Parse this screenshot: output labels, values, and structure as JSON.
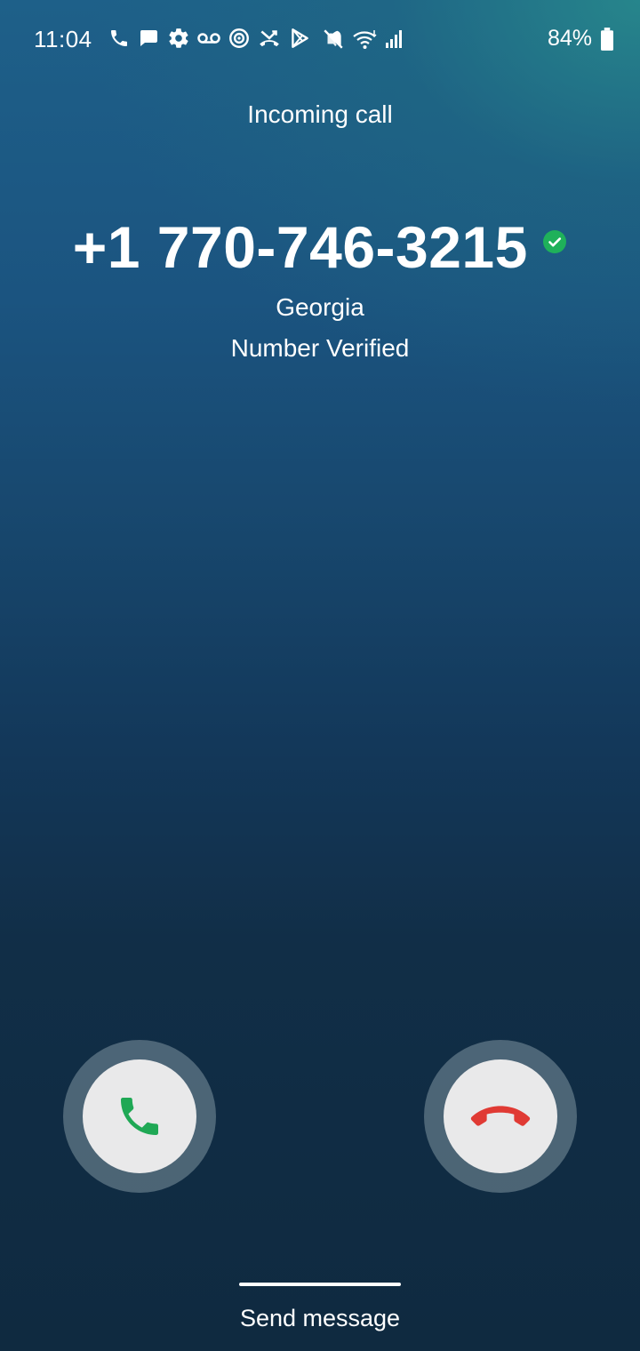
{
  "status_bar": {
    "time": "11:04",
    "icons": [
      "phone-icon",
      "message-icon",
      "settings-icon",
      "voicemail-icon",
      "target-icon",
      "missed-call-icon",
      "play-store-icon",
      "mute-icon",
      "wifi-icon",
      "signal-icon",
      "battery-icon"
    ],
    "battery_percent": "84%"
  },
  "call": {
    "header": "Incoming call",
    "number": "+1 770-746-3215",
    "location": "Georgia",
    "verification": "Number Verified"
  },
  "actions": {
    "answer_icon": "phone-icon",
    "decline_icon": "hang-up-icon",
    "answer_color": "#1fa855",
    "decline_color": "#e03a34"
  },
  "footer": {
    "send_message": "Send message"
  },
  "colors": {
    "verified": "#1fb15a",
    "button_bg": "#e9e9ea"
  }
}
